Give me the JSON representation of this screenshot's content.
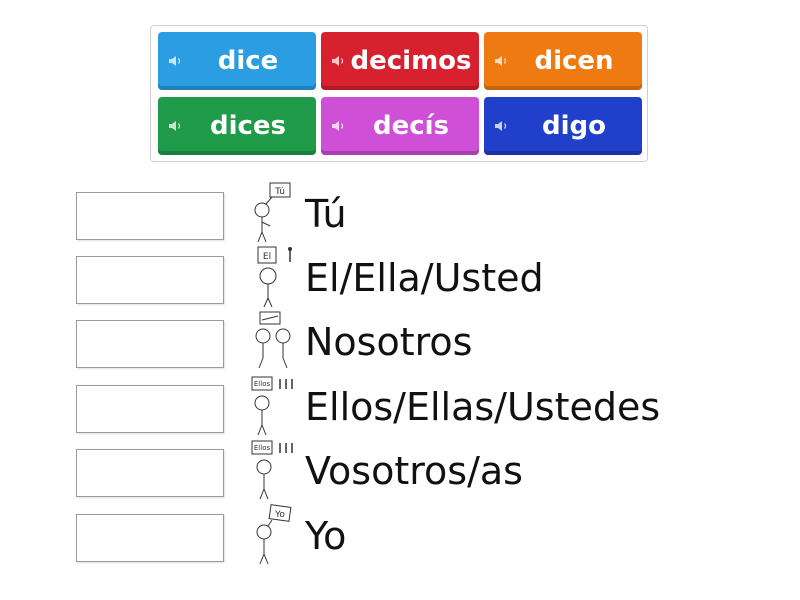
{
  "word_bank": {
    "tiles": [
      {
        "label": "dice",
        "color": "#2a9de3"
      },
      {
        "label": "decimos",
        "color": "#d8212f"
      },
      {
        "label": "dicen",
        "color": "#f07a12"
      },
      {
        "label": "dices",
        "color": "#1f9b4a"
      },
      {
        "label": "decís",
        "color": "#cf4fd6"
      },
      {
        "label": "digo",
        "color": "#2040cc"
      }
    ]
  },
  "targets": [
    {
      "label": "Tú",
      "sign": "Tú"
    },
    {
      "label": "El/Ella/Usted",
      "sign": "El"
    },
    {
      "label": "Nosotros",
      "sign": ""
    },
    {
      "label": "Ellos/Ellas/Ustedes",
      "sign": "Ellos"
    },
    {
      "label": "Vosotros/as",
      "sign": "Ellos"
    },
    {
      "label": "Yo",
      "sign": "Yo"
    }
  ]
}
